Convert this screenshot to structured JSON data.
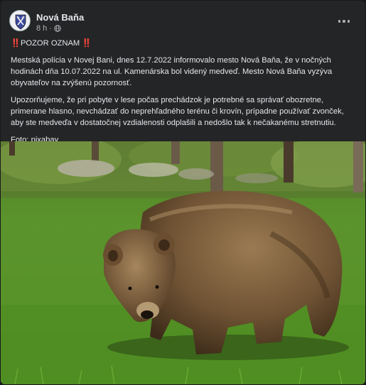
{
  "post": {
    "author": "Nová Baňa",
    "time": "8 h",
    "separator": "·",
    "headline_marks_left": "‼️",
    "headline": "POZOR OZNAM",
    "headline_marks_right": "‼️",
    "paragraph1": "Mestská polícia v Novej Bani, dnes 12.7.2022 informovalo mesto Nová Baňa, že v nočných hodinách dňa 10.07.2022 na ul. Kamenárska bol videný medveď. Mesto Nová Baňa vyzýva obyvateľov na zvýšenú pozornosť.",
    "paragraph2": "Upozorňujeme, že pri pobyte v lese počas prechádzok je potrebné sa správať obozretne, primerane hlasno, nevchádzať do neprehľadného terénu či krovín, prípadne používať zvonček, aby ste medveďa v dostatočnej vzdialenosti odplašili a nedošlo tak k nečakanému stretnutiu.",
    "photo_credit": "Foto: pixabay"
  },
  "icons": {
    "audience": "globe-icon",
    "menu": "more-options-icon"
  },
  "colors": {
    "card_background": "#242526",
    "text_primary": "#e4e6eb",
    "text_secondary": "#b0b3b8",
    "alert_red": "#e0245e"
  }
}
